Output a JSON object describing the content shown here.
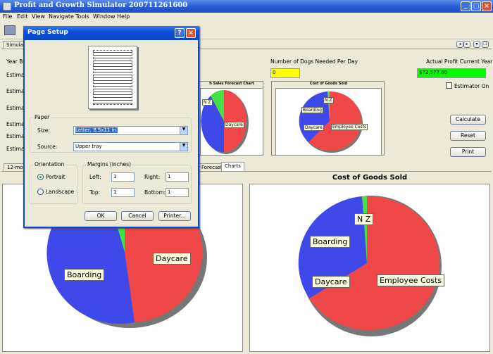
{
  "window": {
    "title": "Profit and Growth Simulator 200711261600",
    "buttons": [
      "_",
      "□",
      "×"
    ]
  },
  "menu": [
    "File",
    "Edit",
    "View",
    "Navigate",
    "Tools",
    "Window",
    "Help"
  ],
  "top_tab": "Simulat",
  "side_labels": [
    "Year Be",
    "Estimat",
    "Estimat",
    "Estimat",
    "Estimat",
    "Estimat",
    "Estimat"
  ],
  "dogs": {
    "label": "Number of Dogs Needed Per Day",
    "value": "0"
  },
  "profit": {
    "label": "Actual Profit Current Year",
    "value": "$72,577.60"
  },
  "estimator": {
    "label": "Estimator On"
  },
  "actions": {
    "calculate": "Calculate",
    "reset": "Reset",
    "print": "Print"
  },
  "mini_charts": {
    "sales_title": "h Sales Forecast Chart",
    "cogs_title": "Cost of Goods Sold",
    "sales_labels": {
      "daycare": "Daycare",
      "nz": "N Z"
    },
    "cogs_labels": {
      "boarding": "Boarding",
      "daycare": "Daycare",
      "employee": "Employee Costs",
      "nz": "N Z"
    }
  },
  "bottom_tabs": {
    "first": "12-mon",
    "forecast": "Forecast",
    "charts": "Charts"
  },
  "large_charts": {
    "left_labels": {
      "boarding": "Boarding",
      "daycare": "Daycare"
    },
    "right_title": "Cost of Goods Sold",
    "right_labels": {
      "nz": "N Z",
      "boarding": "Boarding",
      "daycare": "Daycare",
      "employee": "Employee Costs"
    }
  },
  "dialog": {
    "title": "Page Setup",
    "help": "?",
    "close": "×",
    "paper_group": "Paper",
    "size_label": "Size:",
    "size_value": "Letter, 8.5x11 in.",
    "source_label": "Source:",
    "source_value": "Upper tray",
    "orientation_group": "Orientation",
    "portrait": "Portrait",
    "landscape": "Landscape",
    "margins_group": "Margins (inches)",
    "left_label": "Left:",
    "left_value": "1",
    "right_label": "Right:",
    "right_value": "1",
    "top_label": "Top:",
    "top_value": "1",
    "bottom_label": "Bottom:",
    "bottom_value": "1",
    "ok": "OK",
    "cancel": "Cancel",
    "printer": "Printer..."
  },
  "colors": {
    "red": "#f04848",
    "blue": "#3f48e8",
    "green": "#46e046",
    "yellow": "#ffff00",
    "profit_green": "#00ff00"
  }
}
